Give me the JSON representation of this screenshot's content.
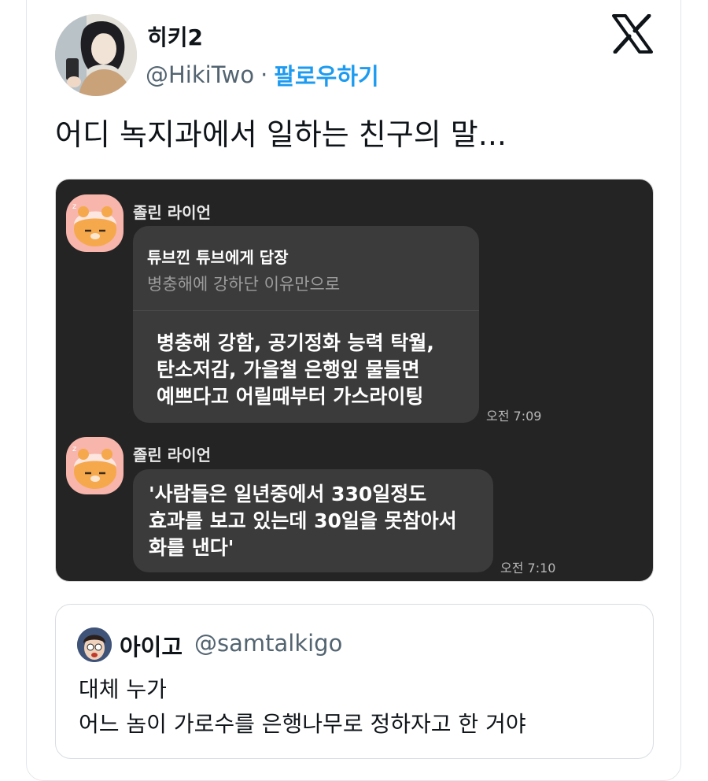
{
  "tweet": {
    "author_name": "히키2",
    "handle": "@HikiTwo",
    "separator": "·",
    "follow_label": "팔로우하기",
    "text": "어디 녹지과에서 일하는 친구의 말...",
    "logo_icon": "x-logo-icon"
  },
  "chat": {
    "messages": [
      {
        "sender": "졸린 라이언",
        "reply_to": "튜브낀 튜브에게 답장",
        "reply_quote": "병충해에 강하단 이유만으로",
        "lines": [
          "병충해 강함, 공기정화 능력 탁월,",
          "탄소저감, 가을철 은행잎 물들면",
          "예쁘다고 어릴때부터 가스라이팅"
        ],
        "time": "오전 7:09"
      },
      {
        "sender": "졸린 라이언",
        "lines": [
          "'사람들은 일년중에서 330일정도",
          "효과를 보고 있는데 30일을 못참아서",
          "화를 낸다'"
        ],
        "time": "오전 7:10"
      }
    ]
  },
  "quote": {
    "name": "아이고",
    "handle": "@samtalkigo",
    "lines": [
      "대체 누가",
      "어느 놈이 가로수를 은행나무로 정하자고 한 거야"
    ]
  },
  "colors": {
    "accent": "#1d9bf0",
    "chat_background": "#242424",
    "bubble": "#3b3b3b",
    "avatar_pink": "#f7b5ac"
  }
}
